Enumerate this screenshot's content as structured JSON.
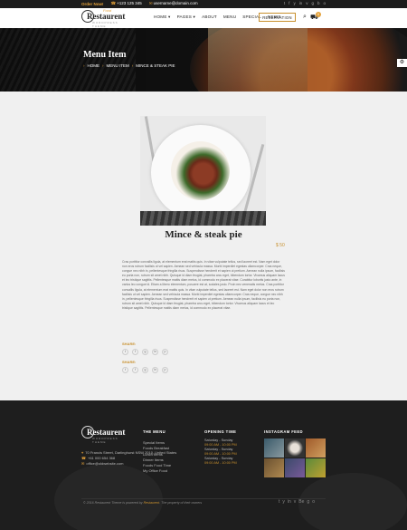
{
  "topbar": {
    "call_label": "Order Now!",
    "phone": "+123 125 345",
    "email": "username@domain.com",
    "social": [
      "t",
      "f",
      "y",
      "in",
      "v",
      "g",
      "b",
      "o"
    ]
  },
  "header": {
    "logo_text": "Restaurent",
    "logo_sub": "WORDPRESS THEME",
    "logo_badge": "Food",
    "nav": [
      "Home ▾",
      "Pages ▾",
      "About",
      "Menu",
      "Special",
      "News"
    ],
    "reserve_label": "RESERVATION",
    "search_icon": "⌕",
    "cart_icon": "🛒",
    "cart_count": "0"
  },
  "hero": {
    "title": "Menu Item",
    "breadcrumb": [
      "HOME",
      "MENU ITEM",
      "MINCE & STEAK PIE"
    ],
    "sep": "›",
    "gear_icon": "⚙"
  },
  "product": {
    "title": "Mince & steak pie",
    "price": "$ 50",
    "description": "Cras porttitor convallis ligula, at elementum erat mattis quis. In vitae vulputate tellus, sed laoreet est. Nam eget dolor non eros rutrum facilisis ut vel sapien. Aenean sed vehicula massa. Morbi imperdiet egestas ullamcorper. Cras neque, congue nec nibh in, pellentesque fringilla risus. Suspendisse hendrerit et sapien ut pretium. Aenean nulla ipsum, facilisis eu porta non, rutrum sit amet nibh. Quisque id diam feugiat, pharetra arcu eget, bibendum tortor. Vivamus aliquam lacus et leo tristique sagittis. Pellentesque mattis diam metus, id commodo ex placerat vitae. Curabitur lobortis justo ante, in varius leo congue id. Etiam a libero elementum, posuere est at, sodales justo. Proin nec venenatis metus. Cras porttitor convallis ligula, at elementum erat mattis quis. In vitae vulputate tellus, sed laoreet est. Nam eget dolor non eros rutrum facilisis ut vel sapien. Aenean sed vehicula massa. Morbi imperdiet egestas ullamcorper. Cras neque, congue nec nibh in, pellentesque fringilla risus. Suspendisse hendrerit et sapien ut pretium. Aenean nulla ipsum, facilisis eu porta non, rutrum sit amet nibh. Quisque id diam feugiat, pharetra arcu eget, bibendum tortor. Vivamus aliquam lacus et leo tristique sagittis. Pellentesque mattis diam metus, id commodo ex placerat vitae.",
    "share_label": "Share:",
    "share_label2": "Share:",
    "share_icons": [
      "t",
      "f",
      "g",
      "in",
      "p"
    ]
  },
  "footer": {
    "logo_text": "Restaurent",
    "logo_sub": "WORDPRESS THEME",
    "address": "70 Francis Street, Darlinghurst NSW 2010, United States",
    "phone": "+61 000 654 368",
    "email": "office@oldwebsite.com",
    "menu_title": "THE MENU",
    "menu_items": [
      "Special Items",
      "Foods Breakfast",
      "Lunch Items",
      "Dinner Items",
      "Foods Food Time",
      "My Office Food"
    ],
    "hours_title": "OPENING TIME",
    "hours": [
      {
        "days": "Saturday - Sunday",
        "time": "09:00 AM - 10:00 PM"
      },
      {
        "days": "Saturday - Sunday",
        "time": "09:00 AM - 10:00 PM"
      },
      {
        "days": "Saturday - Sunday",
        "time": "09:00 AM - 10:00 PM"
      }
    ],
    "insta_title": "INSTAGRAM FEED",
    "copyright_pre": "© 2016 Restaurent Theme is powered by",
    "copyright_brand": "Restaurent",
    "copyright_post": ". The property of their owners",
    "social": [
      "t",
      "y",
      "in",
      "v",
      "Be",
      "g",
      "o"
    ]
  },
  "colors": {
    "accent": "#c8902e",
    "dark": "#1e1e1e",
    "bg": "#f0f0f0"
  }
}
